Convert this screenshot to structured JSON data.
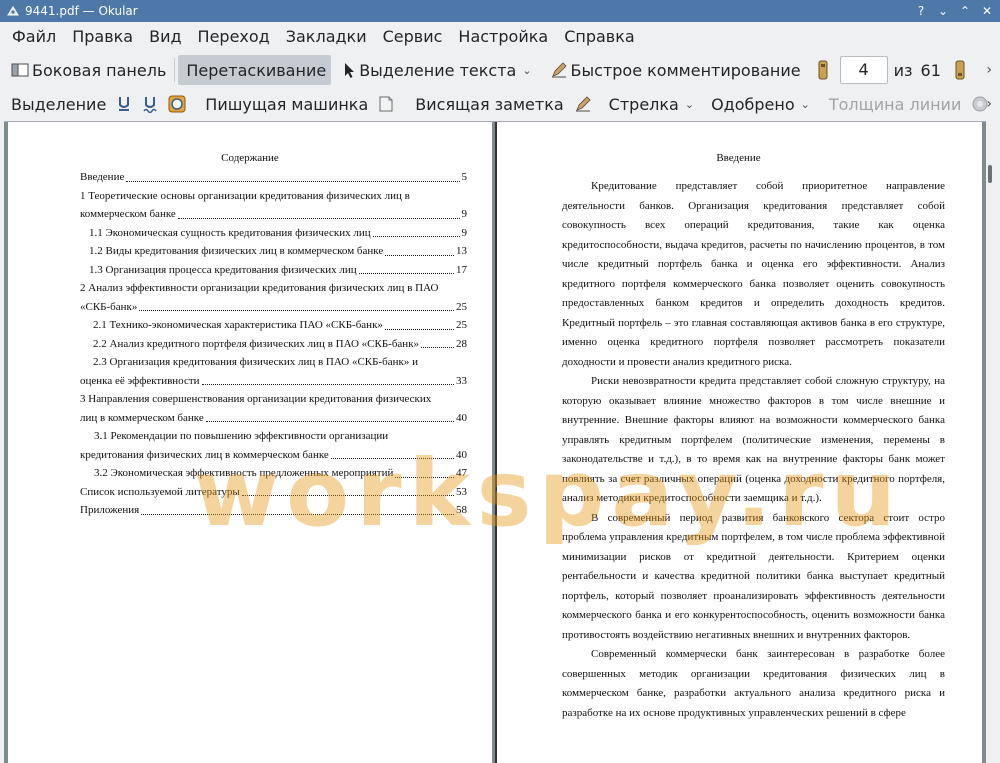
{
  "window": {
    "title": "9441.pdf — Okular",
    "controls": {
      "help": "?",
      "minimize": "⌄",
      "maximize": "⌃",
      "close": "✕"
    }
  },
  "menu": [
    "Файл",
    "Правка",
    "Вид",
    "Переход",
    "Закладки",
    "Сервис",
    "Настройка",
    "Справка"
  ],
  "toolbar1": {
    "sidebar": "Боковая панель",
    "drag": "Перетаскивание",
    "text_select": "Выделение текста",
    "quick_comment": "Быстрое комментирование",
    "page_current": "4",
    "page_of": "из",
    "page_total": "61"
  },
  "toolbar2": {
    "selection": "Выделение",
    "typewriter": "Пишущая машинка",
    "pinned_note": "Висящая заметка",
    "arrow": "Стрелка",
    "approved": "Одобрено",
    "line_width": "Толщина линии"
  },
  "left_page": {
    "title": "Содержание",
    "entries": [
      {
        "text": "Введение",
        "page": "5"
      },
      {
        "line1": "1 Теоретические основы организации кредитования физических лиц в",
        "text": "коммерческом банке",
        "page": "9"
      },
      {
        "text": "1.1  Экономическая сущность кредитования физических лиц",
        "page": "9"
      },
      {
        "text": "1.2 Виды кредитования физических лиц в коммерческом банке",
        "page": "13"
      },
      {
        "text": "1.3 Организация процесса кредитования физических лиц",
        "page": "17"
      },
      {
        "line1": "2 Анализ эффективности организации кредитования физических лиц в ПАО",
        "text": "«СКБ-банк»",
        "page": "25"
      },
      {
        "text": "2.1 Технико-экономическая характеристика ПАО «СКБ-банк»",
        "page": "25"
      },
      {
        "text": "2.2 Анализ кредитного портфеля физических лиц в ПАО «СКБ-банк»",
        "page": "28"
      },
      {
        "line1": "2.3 Организация кредитования физических лиц в ПАО «СКБ-банк» и",
        "text": "оценка её эффективности",
        "page": "33"
      },
      {
        "line1": "3 Направления совершенствования организации кредитования физических",
        "text": "лиц в коммерческом банке",
        "page": "40"
      },
      {
        "line1": "3.1 Рекомендации по повышению эффективности организации",
        "text": "кредитования физических лиц в коммерческом банке",
        "page": "40"
      },
      {
        "text": "3.2 Экономическая эффективность предложенных мероприятий",
        "page": "47"
      },
      {
        "text": "Список используемой литературы",
        "page": "53"
      },
      {
        "text": "Приложения",
        "page": "58"
      }
    ]
  },
  "right_page": {
    "title": "Введение",
    "paragraphs": [
      "Кредитование представляет собой приоритетное направление деятельности банков. Организация кредитования представляет собой совокупность всех операций кредитования, такие как оценка кредитоспособности, выдача кредитов, расчеты по начислению процентов, в том числе кредитный портфель банка и оценка его эффективности. Анализ кредитного портфеля коммерческого банка позволяет оценить совокупность предоставленных банком кредитов и определить доходность кредитов. Кредитный портфель – это главная составляющая активов банка в его структуре, именно оценка кредитного портфеля позволяет рассмотреть показатели доходности и провести анализ кредитного риска.",
      "Риски невозвратности кредита представляет собой сложную структуру, на которую оказывает влияние множество факторов в том числе внешние и внутренние. Внешние факторы влияют на возможности коммерческого банка управлять кредитным портфелем (политические изменения, перемены в законодательстве и т.д.), в то время как на внутренние факторы банк может повлиять за счет различных операций (оценка доходности кредитного портфеля, анализ методики кредитоспособности заемщика и т.д.).",
      "В современный период развития банковского сектора стоит остро проблема управления кредитным портфелем, в том числе проблема эффективной минимизации рисков от кредитной деятельности. Критерием оценки рентабельности и качества кредитной политики банка выступает кредитный портфель, который позволяет проанализировать эффективность деятельности коммерческого банка и его конкурентоспособность, оценить возможности банка противостоять воздействию негативных внешних и внутренних факторов.",
      "Современный коммерчески банк заинтересован в разработке более совершенных методик организации кредитования физических лиц в коммерческом банке, разработки актуального анализа кредитного риска и разработке на их основе продуктивных управленческих решений в сфере"
    ]
  },
  "watermark": "workspay.ru",
  "colors": {
    "titlebar": "#4e78a8",
    "window_bg": "#eff0f1",
    "active_button": "#c5cbd1",
    "watermark": "#e69614"
  }
}
